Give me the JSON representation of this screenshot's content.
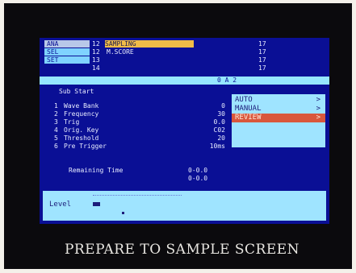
{
  "tabs": [
    "ANA",
    "SEL",
    "SET"
  ],
  "channels": [
    {
      "num": "12",
      "name": "SAMPLING",
      "val": "17"
    },
    {
      "num": "12",
      "name": "M.SCORE",
      "val": "17"
    },
    {
      "num": "13",
      "name": "",
      "val": "17"
    },
    {
      "num": "14",
      "name": "",
      "val": "17"
    }
  ],
  "status": {
    "right": "0 A 2"
  },
  "sub_label": "Sub Start",
  "params": [
    {
      "num": "1",
      "label": "Wave Bank",
      "val": "0"
    },
    {
      "num": "2",
      "label": "Frequency",
      "val": "30"
    },
    {
      "num": "3",
      "label": "Trig",
      "val": "0.0"
    },
    {
      "num": "4",
      "label": "Orig. Key",
      "val": "C02"
    },
    {
      "num": "5",
      "label": "Threshold",
      "val": "20"
    },
    {
      "num": "6",
      "label": "Pre Trigger",
      "val": "10ms"
    }
  ],
  "mode_menu": {
    "items": [
      {
        "label": "AUTO",
        "arrow": ">"
      },
      {
        "label": "MANUAL",
        "arrow": ">"
      },
      {
        "label": "REVIEW",
        "arrow": ">"
      }
    ],
    "selected_index": 2
  },
  "time": {
    "label": "Remaining Time",
    "val1": "0-0.0",
    "val2": "0-0.0"
  },
  "level": {
    "label": "Level",
    "meter_fraction": 0.08
  },
  "caption": "PREPARE TO SAMPLE SCREEN",
  "colors": {
    "screen_bg": "#0a0f95",
    "panel": "#9fe4ff",
    "highlight": "#f0bc48",
    "menu_select": "#d9573c"
  }
}
